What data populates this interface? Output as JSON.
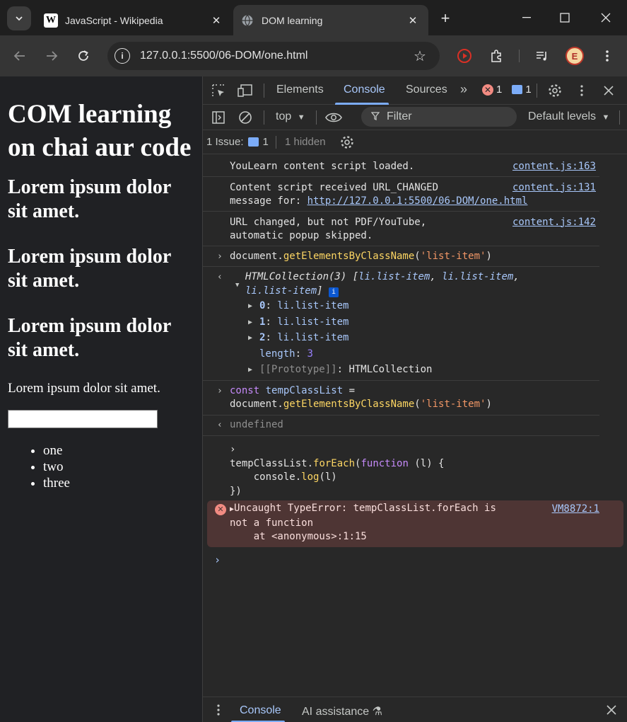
{
  "browser": {
    "tabs": [
      {
        "title": "JavaScript - Wikipedia",
        "favicon": "wikipedia-w",
        "active": false
      },
      {
        "title": "DOM learning",
        "favicon": "globe-icon",
        "active": true
      }
    ],
    "url": "127.0.0.1:5500/06-DOM/one.html",
    "profile_initial": "E"
  },
  "page": {
    "heading": "COM learning on chai aur code",
    "subheadings": [
      "Lorem ipsum dolor sit amet.",
      "Lorem ipsum dolor sit amet.",
      "Lorem ipsum dolor sit amet."
    ],
    "paragraph": "Lorem ipsum dolor sit amet.",
    "list_items": [
      "one",
      "two",
      "three"
    ]
  },
  "devtools": {
    "tabs": [
      "Elements",
      "Console",
      "Sources"
    ],
    "active_tab": "Console",
    "error_count": "1",
    "message_count": "1",
    "context": "top",
    "filter_placeholder": "Filter",
    "levels": "Default levels",
    "issues_label": "1 Issue:",
    "issues_count": "1",
    "hidden_label": "1 hidden",
    "console": {
      "log1": {
        "text": "YouLearn content script loaded.",
        "src": "content.js:163"
      },
      "log2": {
        "line1": "Content script received URL_CHANGED",
        "line2_prefix": "message for: ",
        "line2_link": "http://127.0.0.1:5500/06-DOM/one.html",
        "src": "content.js:131"
      },
      "log3": {
        "line1": "URL changed, but not PDF/YouTube,",
        "line2": "automatic popup skipped.",
        "src": "content.js:142"
      },
      "input1": {
        "obj": "document.",
        "fn": "getElementsByClassName",
        "open": "(",
        "arg": "'list-item'",
        "close": ")"
      },
      "result1": {
        "head": "HTMLCollection(3) [",
        "head_item1": "li.list-item",
        "head_sep": ", ",
        "head_item2": "li.list-item",
        "head_sep2": ",",
        "head_item3": "li.list-item",
        "head_end": "]",
        "items": [
          {
            "key": "0",
            "val": "li.list-item"
          },
          {
            "key": "1",
            "val": "li.list-item"
          },
          {
            "key": "2",
            "val": "li.list-item"
          }
        ],
        "length_key": "length",
        "length_val": "3",
        "proto_key": "[[Prototype]]",
        "proto_val": "HTMLCollection"
      },
      "input2": {
        "kw": "const",
        "var": "tempClassList",
        "eq": " =",
        "obj": "document.",
        "fn": "getElementsByClassName",
        "open": "(",
        "arg": "'list-item'",
        "close": ")"
      },
      "result2": "undefined",
      "input3": {
        "obj": "tempClassList.",
        "fn": "forEach",
        "open": "(",
        "kw": "function",
        "params": " (l) {",
        "line2_obj": "    console.",
        "line2_fn": "log",
        "line2_args": "(l)",
        "line3": "})"
      },
      "error": {
        "line1": "Uncaught TypeError: tempClassList.forEach is",
        "line2": "not a function",
        "line3": "    at <anonymous>:1:15",
        "src": "VM8872:1"
      }
    },
    "drawer_tabs": [
      "Console",
      "AI assistance"
    ]
  },
  "colors": {
    "accent": "#a8c7fa",
    "error_bg": "#4e3534",
    "error_icon": "#f28b82"
  }
}
